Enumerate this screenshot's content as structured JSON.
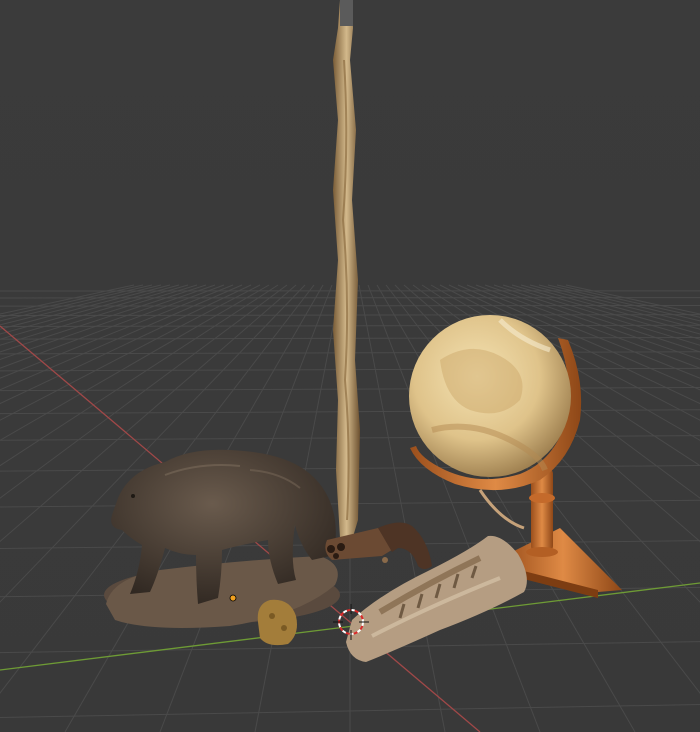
{
  "viewport": {
    "mode": "3d-viewport",
    "background_color": "#393939",
    "grid_color": "#4a4a4a",
    "x_axis_color": "#a04848",
    "y_axis_color": "#6e9b35",
    "grid": true
  },
  "scene": {
    "objects": [
      {
        "name": "bear-statue",
        "color": "#4a3f36"
      },
      {
        "name": "staff",
        "color": "#b89a6a"
      },
      {
        "name": "pepperbox-pistol",
        "color": "#6b4a33"
      },
      {
        "name": "globe",
        "color": "#e2c78e"
      },
      {
        "name": "globe-stand",
        "color": "#c7702f"
      },
      {
        "name": "fossil-jaw",
        "color": "#b59d82"
      },
      {
        "name": "sponge-rock",
        "color": "#a37d3a"
      }
    ],
    "cursor_icon": "3d-cursor-icon",
    "origin_icon": "object-origin-icon"
  }
}
